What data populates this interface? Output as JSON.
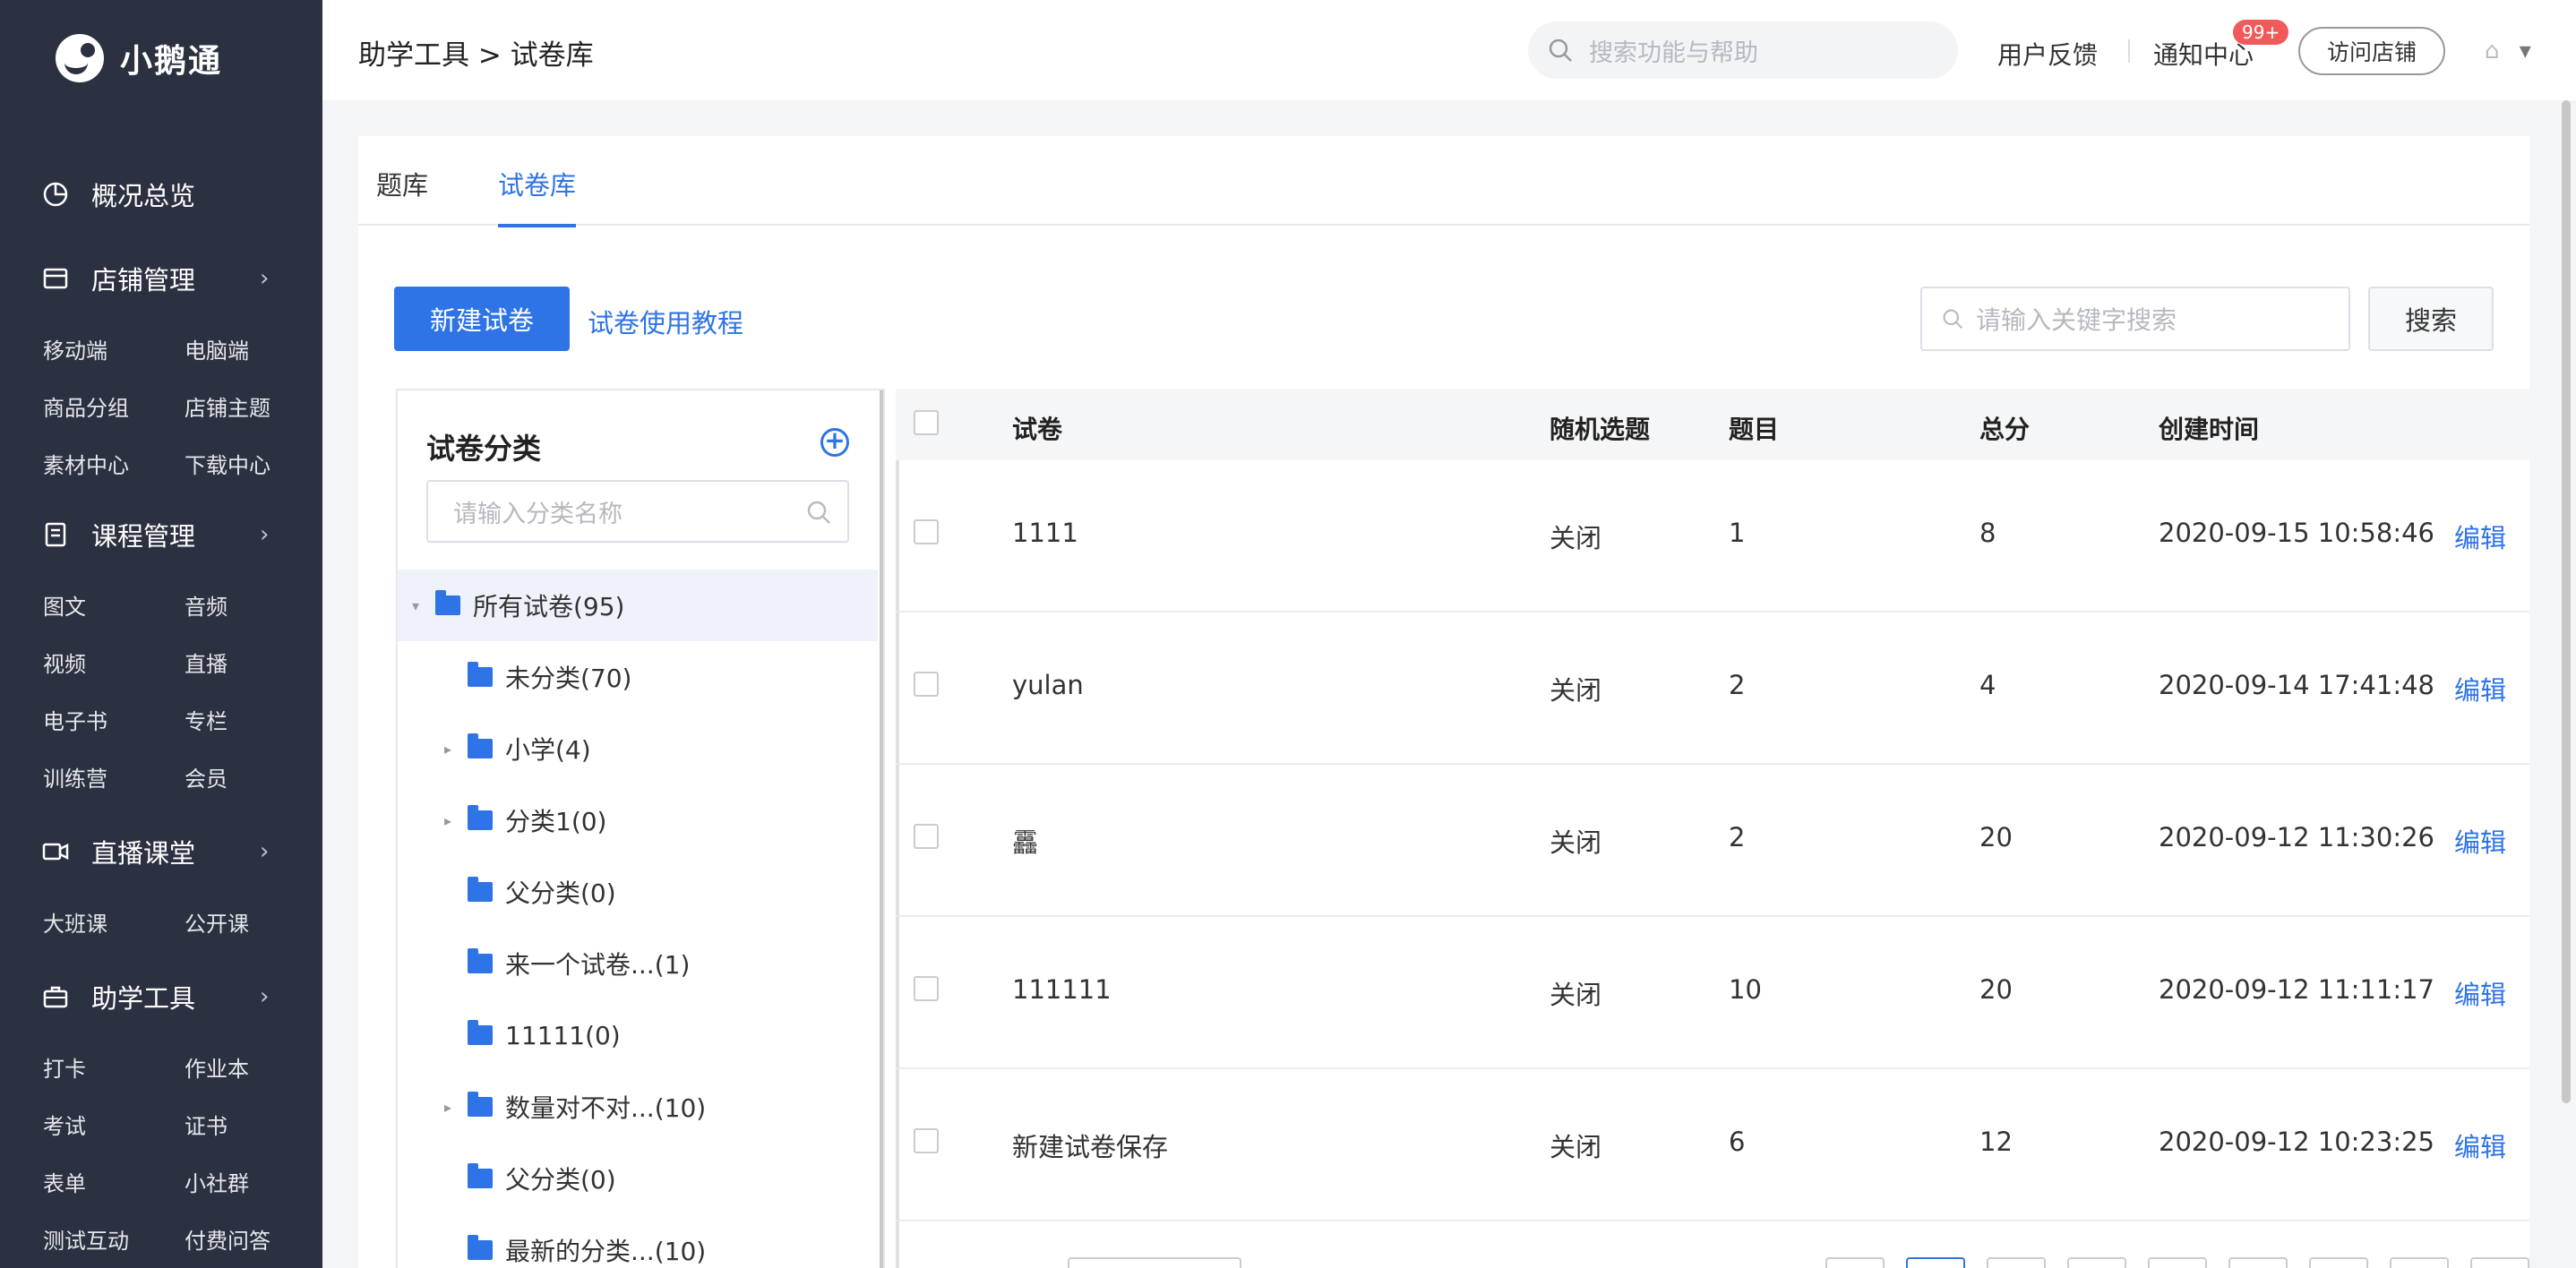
{
  "app": {
    "name": "小鹅通"
  },
  "sidebar": {
    "sections": [
      {
        "label": "概况总览",
        "icon": "pie-chart-icon",
        "has_arrow": false,
        "items": []
      },
      {
        "label": "店铺管理",
        "icon": "store-icon",
        "has_arrow": true,
        "items": [
          "移动端",
          "电脑端",
          "商品分组",
          "店铺主题",
          "素材中心",
          "下载中心"
        ]
      },
      {
        "label": "课程管理",
        "icon": "document-icon",
        "has_arrow": true,
        "items": [
          "图文",
          "音频",
          "视频",
          "直播",
          "电子书",
          "专栏",
          "训练营",
          "会员"
        ]
      },
      {
        "label": "直播课堂",
        "icon": "video-icon",
        "has_arrow": true,
        "items": [
          "大班课",
          "公开课"
        ]
      },
      {
        "label": "助学工具",
        "icon": "briefcase-icon",
        "has_arrow": true,
        "items": [
          "打卡",
          "作业本",
          "考试",
          "证书",
          "表单",
          "小社群",
          "测试互动",
          "付费问答"
        ]
      }
    ]
  },
  "header": {
    "breadcrumb": "助学工具 > 试卷库",
    "search_placeholder": "搜索功能与帮助",
    "feedback": "用户反馈",
    "notifications": "通知中心",
    "badge": "99+",
    "visit_store": "访问店铺",
    "user_caret": "▾"
  },
  "tabs": [
    "题库",
    "试卷库"
  ],
  "active_tab": "试卷库",
  "toolbar": {
    "new_button": "新建试卷",
    "tutorial_link": "试卷使用教程",
    "keyword_placeholder": "请输入关键字搜索",
    "search_button": "搜索"
  },
  "category": {
    "title": "试卷分类",
    "input_placeholder": "请输入分类名称",
    "tree": [
      {
        "label": "所有试卷(95)",
        "level": 0,
        "caret": "▾",
        "selected": true
      },
      {
        "label": "未分类(70)",
        "level": 1,
        "caret": "",
        "selected": false
      },
      {
        "label": "小学(4)",
        "level": 1,
        "caret": "▸",
        "selected": false
      },
      {
        "label": "分类1(0)",
        "level": 1,
        "caret": "▸",
        "selected": false
      },
      {
        "label": "父分类(0)",
        "level": 1,
        "caret": "",
        "selected": false
      },
      {
        "label": "来一个试卷...(1)",
        "level": 1,
        "caret": "",
        "selected": false
      },
      {
        "label": "11111(0)",
        "level": 1,
        "caret": "",
        "selected": false
      },
      {
        "label": "数量对不对...(10)",
        "level": 1,
        "caret": "▸",
        "selected": false
      },
      {
        "label": "父分类(0)",
        "level": 1,
        "caret": "",
        "selected": false
      },
      {
        "label": "最新的分类...(10)",
        "level": 1,
        "caret": "",
        "selected": false
      }
    ]
  },
  "table": {
    "columns": [
      "试卷",
      "随机选题",
      "题目",
      "总分",
      "创建时间"
    ],
    "rows": [
      {
        "name": "1111",
        "random": "关闭",
        "questions": "1",
        "score": "8",
        "created": "2020-09-15 10:58:46",
        "action": "编辑"
      },
      {
        "name": "yulan",
        "random": "关闭",
        "questions": "2",
        "score": "4",
        "created": "2020-09-14 17:41:48",
        "action": "编辑"
      },
      {
        "name": "靐",
        "random": "关闭",
        "questions": "2",
        "score": "20",
        "created": "2020-09-12 11:30:26",
        "action": "编辑"
      },
      {
        "name": "111111",
        "random": "关闭",
        "questions": "10",
        "score": "20",
        "created": "2020-09-12 11:11:17",
        "action": "编辑"
      },
      {
        "name": "新建试卷保存",
        "random": "关闭",
        "questions": "6",
        "score": "12",
        "created": "2020-09-12 10:23:25",
        "action": "编辑"
      }
    ]
  },
  "colors": {
    "accent": "#2e74e6",
    "sidebar_bg": "#2b3140",
    "badge": "#f15a5a"
  }
}
